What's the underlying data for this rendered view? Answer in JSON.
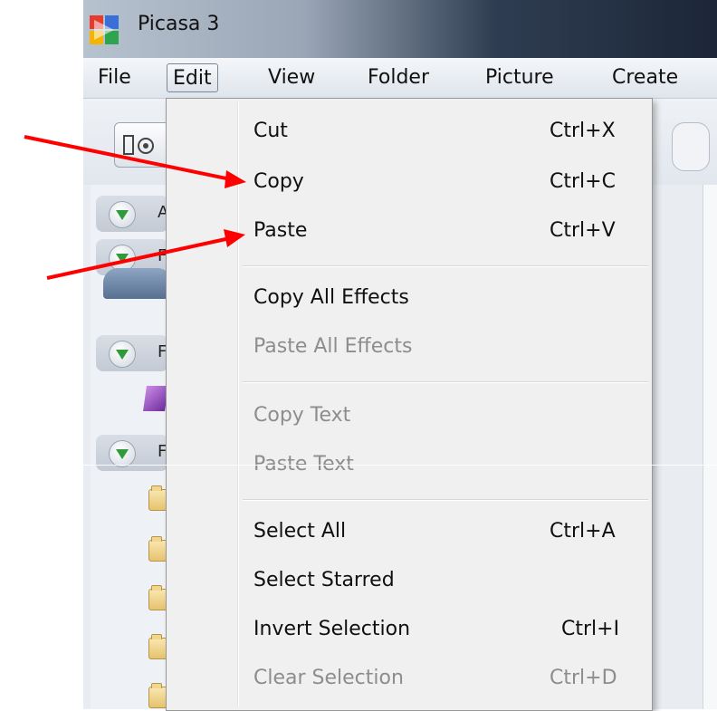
{
  "window": {
    "title": "Picasa 3"
  },
  "menubar": {
    "items": [
      "File",
      "Edit",
      "View",
      "Folder",
      "Picture",
      "Create"
    ]
  },
  "edit_menu": {
    "cut": {
      "label": "Cut",
      "shortcut": "Ctrl+X"
    },
    "copy": {
      "label": "Copy",
      "shortcut": "Ctrl+C"
    },
    "paste": {
      "label": "Paste",
      "shortcut": "Ctrl+V"
    },
    "copy_all_effects": {
      "label": "Copy All Effects"
    },
    "paste_all_effects": {
      "label": "Paste All Effects"
    },
    "copy_text": {
      "label": "Copy Text"
    },
    "paste_text": {
      "label": "Paste Text"
    },
    "select_all": {
      "label": "Select All",
      "shortcut": "Ctrl+A"
    },
    "select_starred": {
      "label": "Select Starred"
    },
    "invert_selection": {
      "label": "Invert Selection",
      "shortcut": "Ctrl+I"
    },
    "clear_selection": {
      "label": "Clear Selection",
      "shortcut": "Ctrl+D"
    }
  },
  "sidebar": {
    "group_letters": [
      "A",
      "F",
      "F",
      "F"
    ]
  },
  "colors": {
    "arrow": "#ff0000",
    "disabled_text": "#8d8d8d",
    "menu_bg": "#f0f0f0"
  },
  "icons": [
    "picasa-app-icon",
    "expand-triangle-icon",
    "folder-icon",
    "red-arrow-annotation"
  ]
}
